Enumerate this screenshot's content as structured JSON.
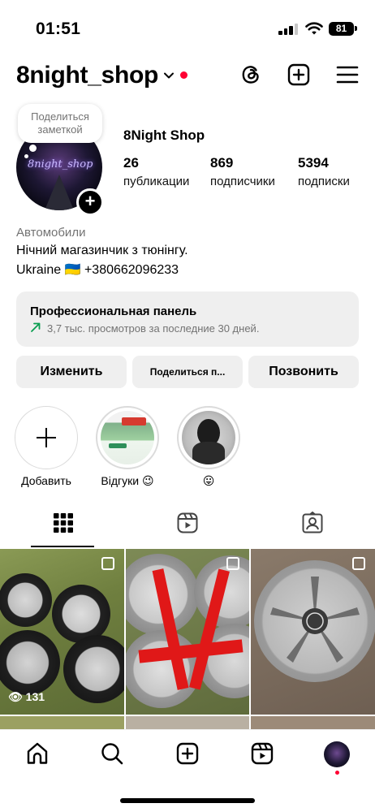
{
  "status_bar": {
    "time": "01:51",
    "battery": "81"
  },
  "header": {
    "username": "8night_shop"
  },
  "note": {
    "text_line1": "Поделиться",
    "text_line2": "заметкой"
  },
  "profile": {
    "display_name": "8Night Shop",
    "stats": [
      {
        "value": "26",
        "label": "публикации"
      },
      {
        "value": "869",
        "label": "подписчики"
      },
      {
        "value": "5394",
        "label": "подписки"
      }
    ],
    "category": "Автомобили",
    "bio_line1": "Нічний магазинчик з тюнінгу.",
    "bio_line2": "Ukraine 🇺🇦 +380662096233"
  },
  "dashboard": {
    "title": "Профессиональная панель",
    "subtitle": "3,7 тыс. просмотров за последние 30 дней."
  },
  "buttons": {
    "edit": "Изменить",
    "share": "Поделиться п...",
    "call": "Позвонить"
  },
  "highlights": [
    {
      "label": "Добавить"
    },
    {
      "label": "Відгуки 😉"
    },
    {
      "label": "😛"
    }
  ],
  "posts": [
    {
      "views": "131"
    }
  ],
  "colors": {
    "accent": "#ff0033",
    "panel_bg": "#efefef",
    "secondary_text": "#737373",
    "trend_green": "#0a9e50"
  },
  "icons": {
    "header": [
      "threads-icon",
      "create-icon",
      "menu-icon"
    ],
    "tabs": [
      "grid-icon",
      "reels-icon",
      "tagged-icon"
    ],
    "nav": [
      "home-icon",
      "search-icon",
      "create-icon",
      "reels-icon",
      "profile-avatar"
    ]
  }
}
